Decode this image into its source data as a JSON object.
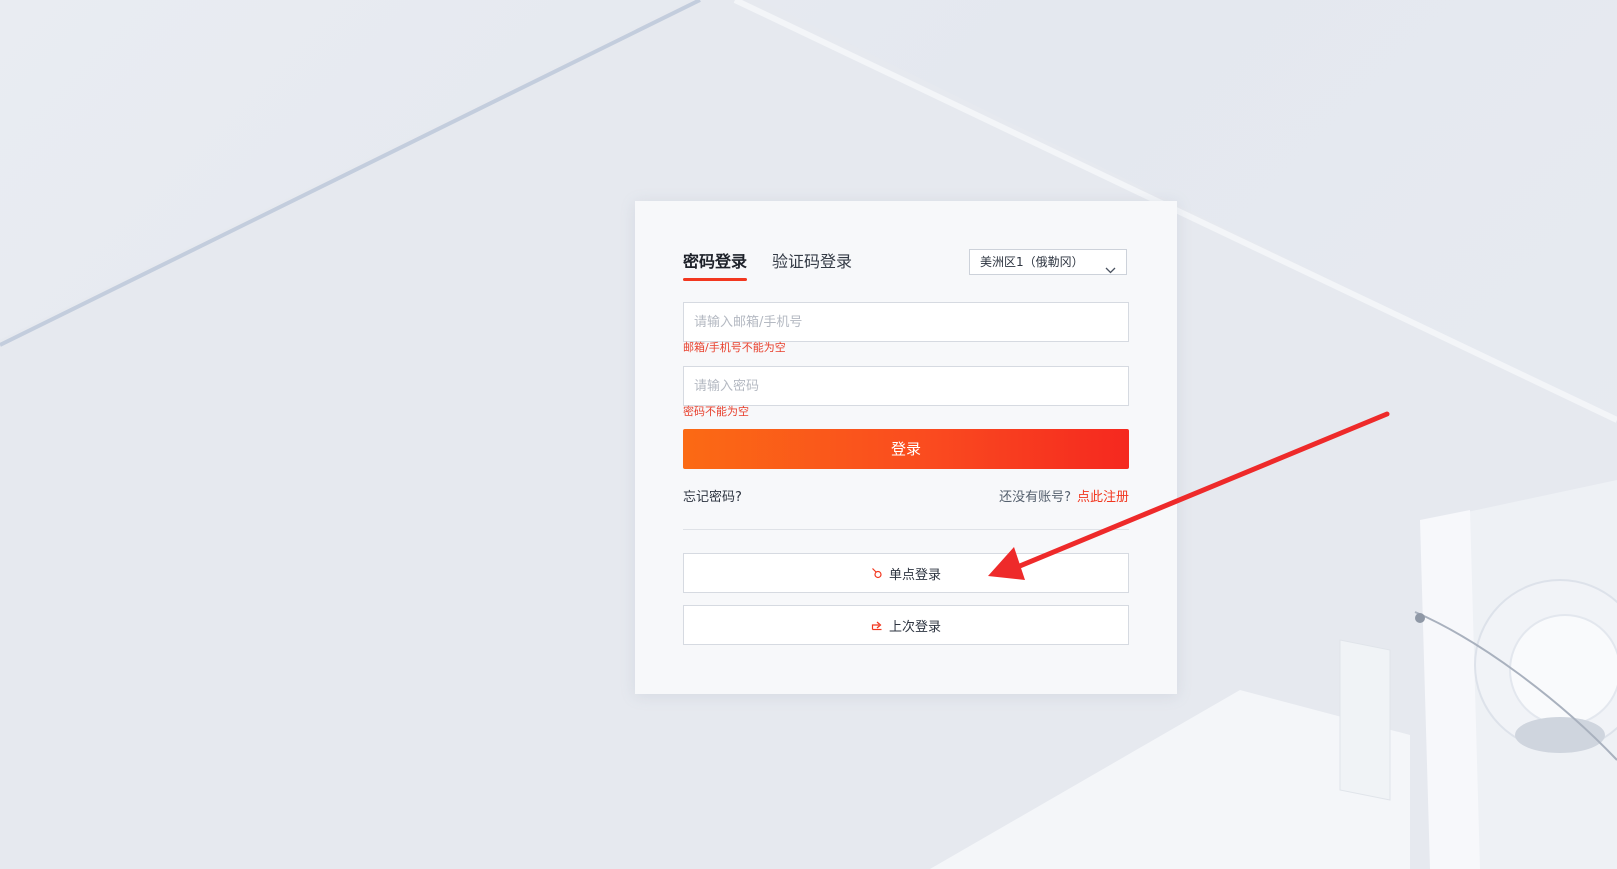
{
  "colors": {
    "accent": "#f2371f",
    "button_gradient_start": "#fb6a14",
    "button_gradient_end": "#f5281f",
    "error": "#e8402d",
    "annotation_arrow": "#ee2a2a"
  },
  "tabs": [
    {
      "label": "密码登录",
      "active": true
    },
    {
      "label": "验证码登录",
      "active": false
    }
  ],
  "region": {
    "selected": "美洲区1（俄勒冈）",
    "icon": "chevron-down-icon"
  },
  "email_field": {
    "value": "",
    "placeholder": "请输入邮箱/手机号",
    "error": "邮箱/手机号不能为空"
  },
  "password_field": {
    "value": "",
    "placeholder": "请输入密码",
    "error": "密码不能为空"
  },
  "login_button": {
    "label": "登录"
  },
  "forgot_password": "忘记密码?",
  "register": {
    "prompt": "还没有账号?",
    "link": "点此注册"
  },
  "sso_button": {
    "label": "单点登录",
    "icon": "link-icon"
  },
  "last_login_button": {
    "label": "上次登录",
    "icon": "share-icon"
  }
}
